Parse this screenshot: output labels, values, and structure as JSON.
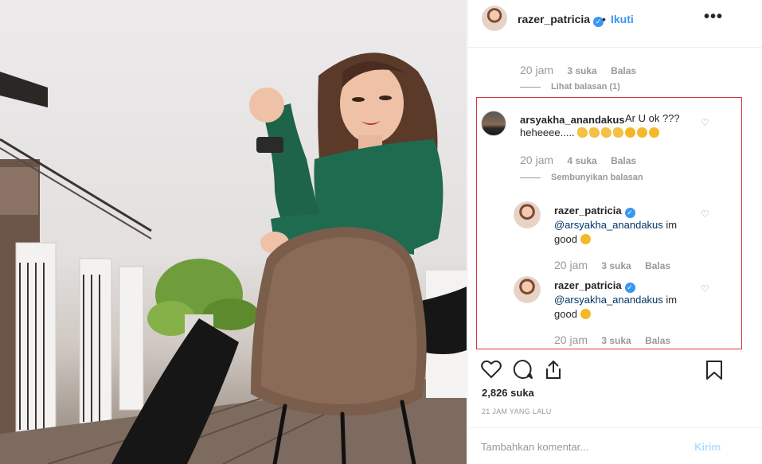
{
  "post": {
    "username": "razer_patricia",
    "separator": "•",
    "follow_label": "Ikuti",
    "more_label": "•••",
    "likes": "2,826 suka",
    "posted": "21 JAM YANG LALU"
  },
  "prev_comment": {
    "time": "20 jam",
    "likes": "3 suka",
    "reply": "Balas",
    "view_replies": "Lihat balasan (1)"
  },
  "main_comment": {
    "username": "arsyakha_anandakus",
    "text_line1": "Ar U ok ???",
    "text_line2": "heheeee.....",
    "time": "20 jam",
    "likes": "4 suka",
    "reply": "Balas",
    "hide_replies": "Sembunyikan balasan"
  },
  "replies": [
    {
      "username": "razer_patricia",
      "mention": "@arsyakha_anandakus",
      "text_tail": " im",
      "text_line2": "good",
      "time": "20 jam",
      "likes": "3 suka",
      "reply": "Balas"
    },
    {
      "username": "razer_patricia",
      "mention": "@arsyakha_anandakus",
      "text_tail": " im",
      "text_line2": "good",
      "time": "20 jam",
      "likes": "3 suka",
      "reply": "Balas"
    }
  ],
  "composer": {
    "placeholder": "Tambahkan komentar...",
    "send_label": "Kirim"
  },
  "colors": {
    "accent": "#3897f0",
    "highlight_border": "#d9343a",
    "sweater": "#1f6b4f",
    "chair": "#7a5d4a"
  }
}
